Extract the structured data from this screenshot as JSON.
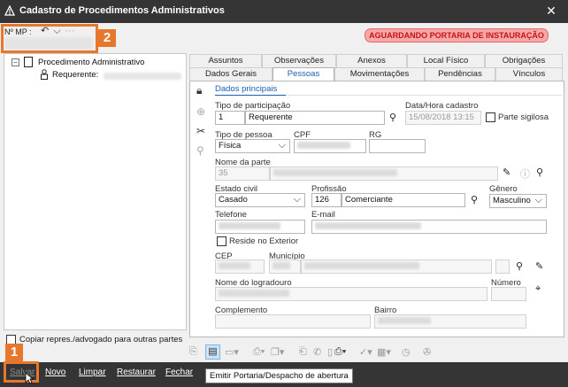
{
  "window": {
    "title": "Cadastro de Procedimentos Administrativos",
    "close_glyph": "✕"
  },
  "header": {
    "mp_label": "Nº MP :",
    "undo_glyph": "↶",
    "dropdown_glyph": "⌵",
    "more_glyph": "···",
    "status_badge": "AGUARDANDO PORTARIA DE INSTAURAÇÃO",
    "status_color": "#c41414"
  },
  "tree": {
    "root_label": "Procedimento Administrativo",
    "child_label": "Requerente:"
  },
  "copy_option": {
    "label": "Copiar repres./advogado para outras partes",
    "checked": false
  },
  "tabs": {
    "row1": [
      "Assuntos",
      "Observações",
      "Anexos",
      "Local Físico",
      "Obrigações"
    ],
    "row2": [
      "Dados Gerais",
      "Pessoas",
      "Movimentações",
      "Pendências",
      "Vínculos"
    ],
    "active": "Pessoas"
  },
  "subtab": {
    "label": "Dados principais"
  },
  "form": {
    "tipo_participacao": {
      "label": "Tipo de participação",
      "code": "1",
      "value": "Requerente"
    },
    "data_hora": {
      "label": "Data/Hora cadastro",
      "value": "15/08/2018 13:15"
    },
    "parte_sigilosa": {
      "label": "Parte sigilosa",
      "checked": false
    },
    "tipo_pessoa": {
      "label": "Tipo de pessoa",
      "value": "Física"
    },
    "cpf": {
      "label": "CPF"
    },
    "rg": {
      "label": "RG"
    },
    "nome_parte": {
      "label": "Nome da parte",
      "code": "35"
    },
    "estado_civil": {
      "label": "Estado civil",
      "value": "Casado"
    },
    "profissao": {
      "label": "Profissão",
      "code": "126",
      "value": "Comerciante"
    },
    "genero": {
      "label": "Gênero",
      "value": "Masculino"
    },
    "telefone": {
      "label": "Telefone"
    },
    "email": {
      "label": "E-mail"
    },
    "reside_exterior": {
      "label": "Reside no Exterior",
      "checked": false
    },
    "cep": {
      "label": "CEP"
    },
    "municipio": {
      "label": "Município"
    },
    "logradouro": {
      "label": "Nome do logradouro"
    },
    "numero": {
      "label": "Número"
    },
    "complemento": {
      "label": "Complemento"
    },
    "bairro": {
      "label": "Bairro"
    }
  },
  "bottom": {
    "buttons": [
      "Salvar",
      "Novo",
      "Limpar",
      "Restaurar",
      "Fechar"
    ],
    "tooltip": "Emitir Portaria/Despacho de abertura"
  },
  "annotations": {
    "marker_1": "1",
    "marker_2": "2",
    "color": "#e8772e"
  }
}
